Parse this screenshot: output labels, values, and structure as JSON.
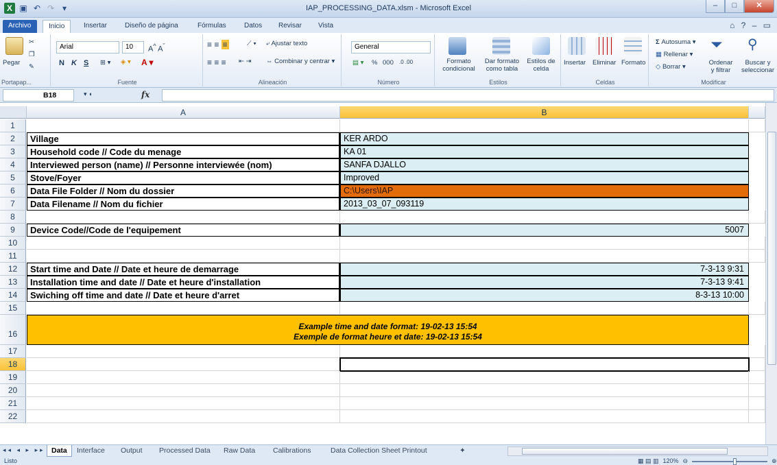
{
  "window": {
    "title": "IAP_PROCESSING_DATA.xlsm - Microsoft Excel"
  },
  "ribbon_tabs": [
    "Archivo",
    "Inicio",
    "Insertar",
    "Diseño de página",
    "Fórmulas",
    "Datos",
    "Revisar",
    "Vista"
  ],
  "ribbon": {
    "clipboard": {
      "paste": "Pegar",
      "label": "Portapap..."
    },
    "font": {
      "name": "Arial",
      "size": "10",
      "bold": "N",
      "italic": "K",
      "underline": "S",
      "label": "Fuente"
    },
    "alignment": {
      "wrap": "Ajustar texto",
      "merge": "Combinar y centrar",
      "label": "Alineación"
    },
    "number": {
      "format": "General",
      "percent": "%",
      "thousands": "000",
      "label": "Número"
    },
    "styles": {
      "conditional_1": "Formato",
      "conditional_2": "condicional",
      "table_1": "Dar formato",
      "table_2": "como tabla",
      "cell_1": "Estilos de",
      "cell_2": "celda",
      "label": "Estilos"
    },
    "cells": {
      "insert": "Insertar",
      "delete": "Eliminar",
      "format": "Formato",
      "label": "Celdas"
    },
    "editing": {
      "autosum": "Autosuma",
      "fill": "Rellenar",
      "clear": "Borrar",
      "sort_1": "Ordenar",
      "sort_2": "y filtrar",
      "find_1": "Buscar y",
      "find_2": "seleccionar",
      "label": "Modificar"
    }
  },
  "formula_bar": {
    "name_box": "B18",
    "fx": "fx",
    "content": ""
  },
  "columns": [
    "A",
    "B"
  ],
  "rows": [
    {
      "n": "1"
    },
    {
      "n": "2",
      "a": "Village",
      "b": "KER ARDO"
    },
    {
      "n": "3",
      "a": "Household code // Code du menage",
      "b": "KA 01"
    },
    {
      "n": "4",
      "a": "Interviewed person (name) // Personne interviewée (nom)",
      "b": "SANFA DJALLO"
    },
    {
      "n": "5",
      "a": "Stove/Foyer",
      "b": "Improved"
    },
    {
      "n": "6",
      "a": "Data File Folder // Nom du dossier",
      "b": "C:\\Users\\IAP"
    },
    {
      "n": "7",
      "a": "Data Filename // Nom du fichier",
      "b": "2013_03_07_093119"
    },
    {
      "n": "8"
    },
    {
      "n": "9",
      "a": "Device Code//Code de l'equipement",
      "b": "5007"
    },
    {
      "n": "10"
    },
    {
      "n": "11"
    },
    {
      "n": "12",
      "a": "Start time and Date // Date et heure de demarrage",
      "b": "7-3-13 9:31"
    },
    {
      "n": "13",
      "a": "Installation time and date // Date et heure d'installation",
      "b": "7-3-13 9:41"
    },
    {
      "n": "14",
      "a": "Swiching off time and date // Date et heure d'arret",
      "b": "8-3-13 10:00"
    },
    {
      "n": "15"
    },
    {
      "n": "16",
      "banner_1": "Example time and date format: 19-02-13 15:54",
      "banner_2": "Exemple de format heure et date: 19-02-13 15:54"
    },
    {
      "n": "17"
    },
    {
      "n": "18"
    },
    {
      "n": "19"
    },
    {
      "n": "20"
    },
    {
      "n": "21"
    },
    {
      "n": "22"
    }
  ],
  "sheets": [
    "Data",
    "Interface",
    "Output",
    "Processed Data",
    "Raw Data",
    "Calibrations",
    "Data Collection Sheet Printout"
  ],
  "status": {
    "ready": "Listo",
    "zoom": "120%"
  },
  "colors": {
    "label_fill": "#dbeef3",
    "folder_fill": "#e36c0a",
    "banner_fill": "#ffc000",
    "selected_header": "#f8c13a"
  }
}
